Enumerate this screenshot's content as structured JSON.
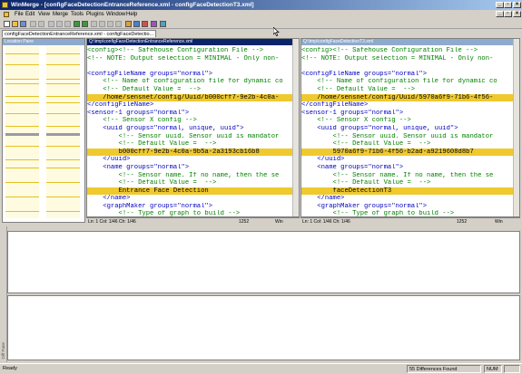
{
  "window": {
    "title": "WinMerge - [configFaceDetectionEntranceReference.xml - configFaceDetectionT3.xml]"
  },
  "menu": [
    "File",
    "Edit",
    "View",
    "Merge",
    "Tools",
    "Plugins",
    "Window",
    "Help"
  ],
  "tabs": [
    "configFaceDetectionEntranceReference.xml - configFaceDetectio..."
  ],
  "location_pane": {
    "title": "Location Pane"
  },
  "left_pane": {
    "path": "Q:\\tmp\\configFaceDetectionEntranceReference.xml",
    "lines": [
      {
        "text": "<config><!-- Safehouse Configuration File -->",
        "cls": "cm",
        "diff": false
      },
      {
        "text": "<!-- NOTE: Output selection = MINIMAL - Only non-",
        "cls": "cm",
        "diff": false
      },
      {
        "text": "",
        "cls": "txt",
        "diff": false
      },
      {
        "text": "<configFileName groups=\"normal\">",
        "cls": "tg",
        "diff": false
      },
      {
        "text": "    <!-- Name of configuration file for dynamic co",
        "cls": "cm",
        "diff": false
      },
      {
        "text": "    <!-- Default Value =  -->",
        "cls": "cm",
        "diff": false
      },
      {
        "text": "    /home/sensnet/config/Uuid/b000cff7-9e2b-4c0a-",
        "cls": "txt",
        "diff": true
      },
      {
        "text": "</configFileName>",
        "cls": "tg",
        "diff": false
      },
      {
        "text": "<sensor-1 groups=\"normal\">",
        "cls": "tg",
        "diff": false
      },
      {
        "text": "    <!-- Sensor X config -->",
        "cls": "cm",
        "diff": false
      },
      {
        "text": "    <uuid groups=\"normal, unique, uuid\">",
        "cls": "tg",
        "diff": false
      },
      {
        "text": "        <!-- Sensor uuid. Sensor uuid is mandator",
        "cls": "cm",
        "diff": false
      },
      {
        "text": "        <!-- Default Value =  -->",
        "cls": "cm",
        "diff": false
      },
      {
        "text": "        b000cff7-9e2b-4c0a-9b5a-2a3193cb16b8",
        "cls": "txt",
        "diff": true
      },
      {
        "text": "    </uuid>",
        "cls": "tg",
        "diff": false
      },
      {
        "text": "    <name groups=\"normal\">",
        "cls": "tg",
        "diff": false
      },
      {
        "text": "        <!-- Sensor name. If no name, then the se",
        "cls": "cm",
        "diff": false
      },
      {
        "text": "        <!-- Default Value =  -->",
        "cls": "cm",
        "diff": false
      },
      {
        "text": "        Entrance Face Detection",
        "cls": "txt",
        "diff": true
      },
      {
        "text": "    </name>",
        "cls": "tg",
        "diff": false
      },
      {
        "text": "    <graphMaker groups=\"normal\">",
        "cls": "tg",
        "diff": false
      },
      {
        "text": "        <!-- Type of graph to build -->",
        "cls": "cm",
        "diff": false
      }
    ],
    "status": {
      "pos": "Ln: 1  Col: 1/46  Ch: 1/46",
      "enc": "1252",
      "eol": "Win"
    }
  },
  "right_pane": {
    "path": "Q:\\tmp\\configFaceDetectionT3.xml",
    "lines": [
      {
        "text": "<config><!-- Safehouse Configuration File -->",
        "cls": "cm",
        "diff": false
      },
      {
        "text": "<!-- NOTE: Output selection = MINIMAL - Only non-",
        "cls": "cm",
        "diff": false
      },
      {
        "text": "",
        "cls": "txt",
        "diff": false
      },
      {
        "text": "<configFileName groups=\"normal\">",
        "cls": "tg",
        "diff": false
      },
      {
        "text": "    <!-- Name of configuration file for dynamic co",
        "cls": "cm",
        "diff": false
      },
      {
        "text": "    <!-- Default Value =  -->",
        "cls": "cm",
        "diff": false
      },
      {
        "text": "    /home/sensnet/config/Uuid/5970a6f9-71b6-4f56-",
        "cls": "txt",
        "diff": true
      },
      {
        "text": "</configFileName>",
        "cls": "tg",
        "diff": false
      },
      {
        "text": "<sensor-1 groups=\"normal\">",
        "cls": "tg",
        "diff": false
      },
      {
        "text": "    <!-- Sensor X config -->",
        "cls": "cm",
        "diff": false
      },
      {
        "text": "    <uuid groups=\"normal, unique, uuid\">",
        "cls": "tg",
        "diff": false
      },
      {
        "text": "        <!-- Sensor uuid. Sensor uuid is mandator",
        "cls": "cm",
        "diff": false
      },
      {
        "text": "        <!-- Default Value =  -->",
        "cls": "cm",
        "diff": false
      },
      {
        "text": "        5970a6f9-71b6-4f56-b2ad-a9219608d8b7",
        "cls": "txt",
        "diff": true
      },
      {
        "text": "    </uuid>",
        "cls": "tg",
        "diff": false
      },
      {
        "text": "    <name groups=\"normal\">",
        "cls": "tg",
        "diff": false
      },
      {
        "text": "        <!-- Sensor name. If no name, then the se",
        "cls": "cm",
        "diff": false
      },
      {
        "text": "        <!-- Default Value =  -->",
        "cls": "cm",
        "diff": false
      },
      {
        "text": "        faceDetectionT3",
        "cls": "txt",
        "diff": true
      },
      {
        "text": "    </name>",
        "cls": "tg",
        "diff": false
      },
      {
        "text": "    <graphMaker groups=\"normal\">",
        "cls": "tg",
        "diff": false
      },
      {
        "text": "        <!-- Type of graph to build -->",
        "cls": "cm",
        "diff": false
      }
    ],
    "status": {
      "pos": "Ln: 1  Col: 1/46  Ch: 1/46",
      "enc": "1252",
      "eol": "Win"
    }
  },
  "diff_pane": {
    "side_label": "Diff Pane"
  },
  "statusbar": {
    "ready": "Ready",
    "diffs": "55 Differences Found",
    "num": "NUM"
  },
  "colors": {
    "diff_highlight": "#efc92e",
    "active_header": "#0a246a",
    "inactive_header": "#8eaacc"
  }
}
